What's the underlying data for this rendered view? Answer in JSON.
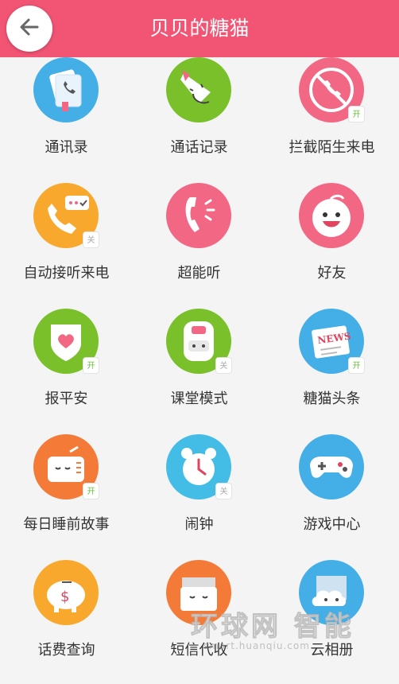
{
  "header": {
    "title": "贝贝的糖猫",
    "back_icon": "arrow-left-icon"
  },
  "colors": {
    "header": "#f25474",
    "blue": "#44aee6",
    "green": "#79c02a",
    "pink": "#f26783",
    "orange": "#f8a92d"
  },
  "badges": {
    "on": "开",
    "off": "关"
  },
  "items": [
    {
      "label": "通讯录",
      "icon": "contacts-icon",
      "badge": ""
    },
    {
      "label": "通话记录",
      "icon": "call-log-icon",
      "badge": ""
    },
    {
      "label": "拦截陌生来电",
      "icon": "block-call-icon",
      "badge": "开"
    },
    {
      "label": "自动接听来电",
      "icon": "auto-answer-icon",
      "badge": "关"
    },
    {
      "label": "超能听",
      "icon": "super-listen-icon",
      "badge": ""
    },
    {
      "label": "好友",
      "icon": "friends-icon",
      "badge": ""
    },
    {
      "label": "报平安",
      "icon": "safety-heart-icon",
      "badge": "开"
    },
    {
      "label": "课堂模式",
      "icon": "class-mode-icon",
      "badge": "关"
    },
    {
      "label": "糖猫头条",
      "icon": "news-icon",
      "badge": "开"
    },
    {
      "label": "每日睡前故事",
      "icon": "bedtime-radio-icon",
      "badge": "开"
    },
    {
      "label": "闹钟",
      "icon": "alarm-clock-icon",
      "badge": "关"
    },
    {
      "label": "游戏中心",
      "icon": "gamepad-icon",
      "badge": ""
    },
    {
      "label": "话费查询",
      "icon": "piggy-bank-icon",
      "badge": ""
    },
    {
      "label": "短信代收",
      "icon": "sms-box-icon",
      "badge": ""
    },
    {
      "label": "云相册",
      "icon": "cloud-album-icon",
      "badge": ""
    }
  ],
  "watermark": {
    "text": "环球网 智能",
    "url": "smart.huanqiu.com"
  }
}
